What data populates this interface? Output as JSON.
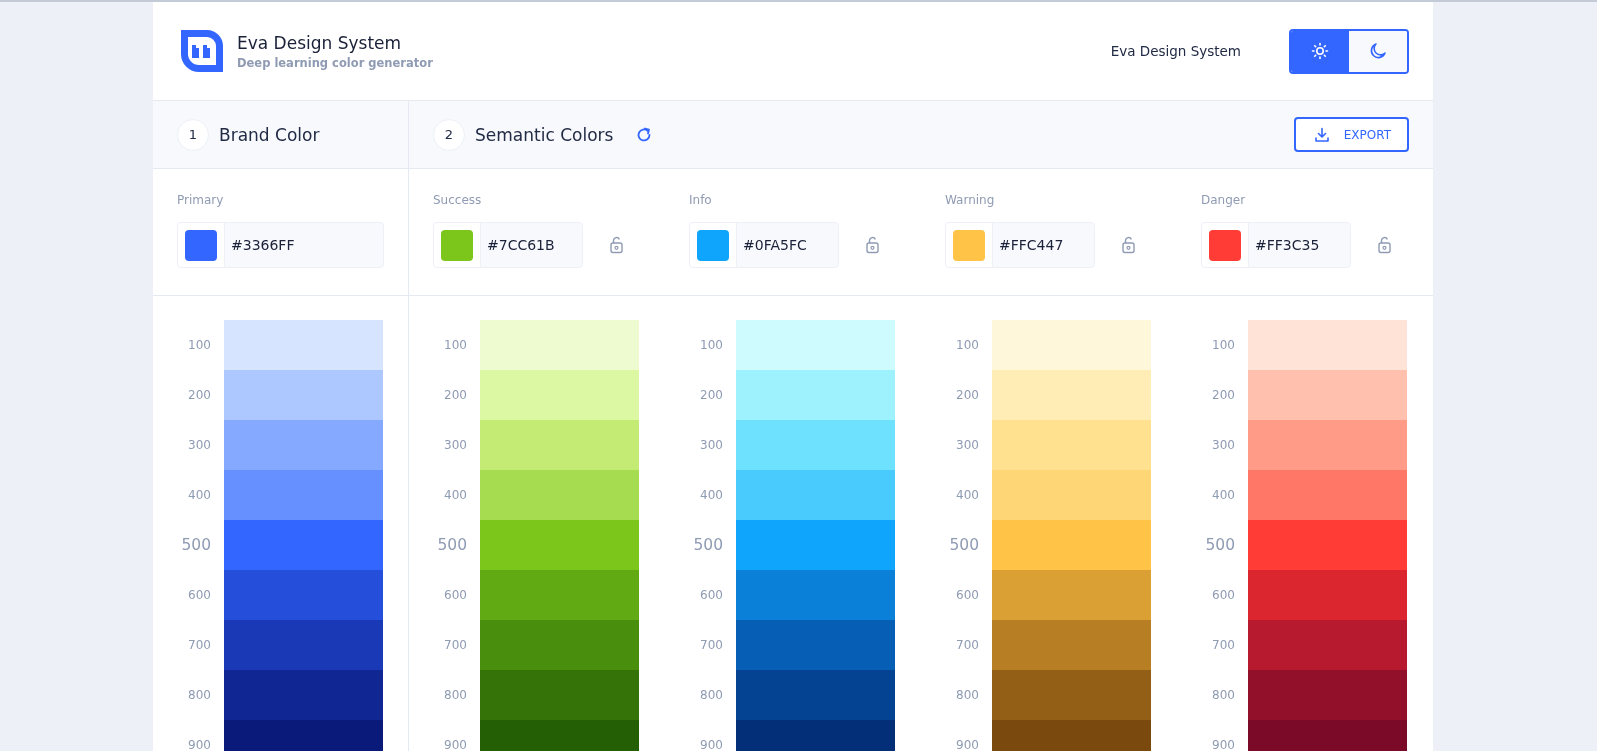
{
  "header": {
    "title": "Eva Design System",
    "subtitle": "Deep learning color generator",
    "link": "Eva Design System",
    "theme_toggle": [
      {
        "kind": "light",
        "selected": true
      },
      {
        "kind": "dark",
        "selected": false
      }
    ]
  },
  "steps": [
    {
      "number": "1",
      "title": "Brand Color",
      "refresh_button": false
    },
    {
      "number": "2",
      "title": "Semantic Colors",
      "refresh_button": true
    }
  ],
  "export_button": "EXPORT",
  "palettes": [
    {
      "label": "Primary",
      "value": "#3366FF",
      "color": "#3366ff",
      "shades": [
        {
          "label": "100",
          "color": "#d6e4ff",
          "base": false
        },
        {
          "label": "200",
          "color": "#adc8ff",
          "base": false
        },
        {
          "label": "300",
          "color": "#84a9ff",
          "base": false
        },
        {
          "label": "400",
          "color": "#6690ff",
          "base": false
        },
        {
          "label": "500",
          "color": "#3366ff",
          "base": true
        },
        {
          "label": "600",
          "color": "#254edb",
          "base": false
        },
        {
          "label": "700",
          "color": "#1939b7",
          "base": false
        },
        {
          "label": "800",
          "color": "#102693",
          "base": false
        },
        {
          "label": "900",
          "color": "#091a7a",
          "base": false
        }
      ]
    },
    {
      "label": "Success",
      "value": "#7CC61B",
      "color": "#7cc61b",
      "locked": false,
      "shades": [
        {
          "label": "100",
          "color": "#eefad0",
          "base": false
        },
        {
          "label": "200",
          "color": "#ddf8a3",
          "base": false
        },
        {
          "label": "300",
          "color": "#c4ec74",
          "base": false
        },
        {
          "label": "400",
          "color": "#a6dc4f",
          "base": false
        },
        {
          "label": "500",
          "color": "#7cc61b",
          "base": true
        },
        {
          "label": "600",
          "color": "#62aa13",
          "base": false
        },
        {
          "label": "700",
          "color": "#4a8e0d",
          "base": false
        },
        {
          "label": "800",
          "color": "#357208",
          "base": false
        },
        {
          "label": "900",
          "color": "#255f05",
          "base": false
        }
      ]
    },
    {
      "label": "Info",
      "value": "#0FA5FC",
      "color": "#0fa5fc",
      "locked": false,
      "shades": [
        {
          "label": "100",
          "color": "#cefbfe",
          "base": false
        },
        {
          "label": "200",
          "color": "#9ef2fe",
          "base": false
        },
        {
          "label": "300",
          "color": "#6de1fe",
          "base": false
        },
        {
          "label": "400",
          "color": "#49cbfd",
          "base": false
        },
        {
          "label": "500",
          "color": "#0fa5fc",
          "base": true
        },
        {
          "label": "600",
          "color": "#0a80d8",
          "base": false
        },
        {
          "label": "700",
          "color": "#075fb5",
          "base": false
        },
        {
          "label": "800",
          "color": "#044392",
          "base": false
        },
        {
          "label": "900",
          "color": "#022f78",
          "base": false
        }
      ]
    },
    {
      "label": "Warning",
      "value": "#FFC447",
      "color": "#ffc447",
      "locked": false,
      "shades": [
        {
          "label": "100",
          "color": "#fff7da",
          "base": false
        },
        {
          "label": "200",
          "color": "#ffedb5",
          "base": false
        },
        {
          "label": "300",
          "color": "#ffe190",
          "base": false
        },
        {
          "label": "400",
          "color": "#ffd675",
          "base": false
        },
        {
          "label": "500",
          "color": "#ffc447",
          "base": true
        },
        {
          "label": "600",
          "color": "#dba033",
          "base": false
        },
        {
          "label": "700",
          "color": "#b77e23",
          "base": false
        },
        {
          "label": "800",
          "color": "#935f16",
          "base": false
        },
        {
          "label": "900",
          "color": "#7a490d",
          "base": false
        }
      ]
    },
    {
      "label": "Danger",
      "value": "#FF3C35",
      "color": "#ff3c35",
      "locked": false,
      "shades": [
        {
          "label": "100",
          "color": "#ffe3d7",
          "base": false
        },
        {
          "label": "200",
          "color": "#ffc1ae",
          "base": false
        },
        {
          "label": "300",
          "color": "#ff9b86",
          "base": false
        },
        {
          "label": "400",
          "color": "#ff7867",
          "base": false
        },
        {
          "label": "500",
          "color": "#ff3c35",
          "base": true
        },
        {
          "label": "600",
          "color": "#db2630",
          "base": false
        },
        {
          "label": "700",
          "color": "#b71a2e",
          "base": false
        },
        {
          "label": "800",
          "color": "#93102a",
          "base": false
        },
        {
          "label": "900",
          "color": "#7a0a27",
          "base": false
        }
      ]
    }
  ]
}
